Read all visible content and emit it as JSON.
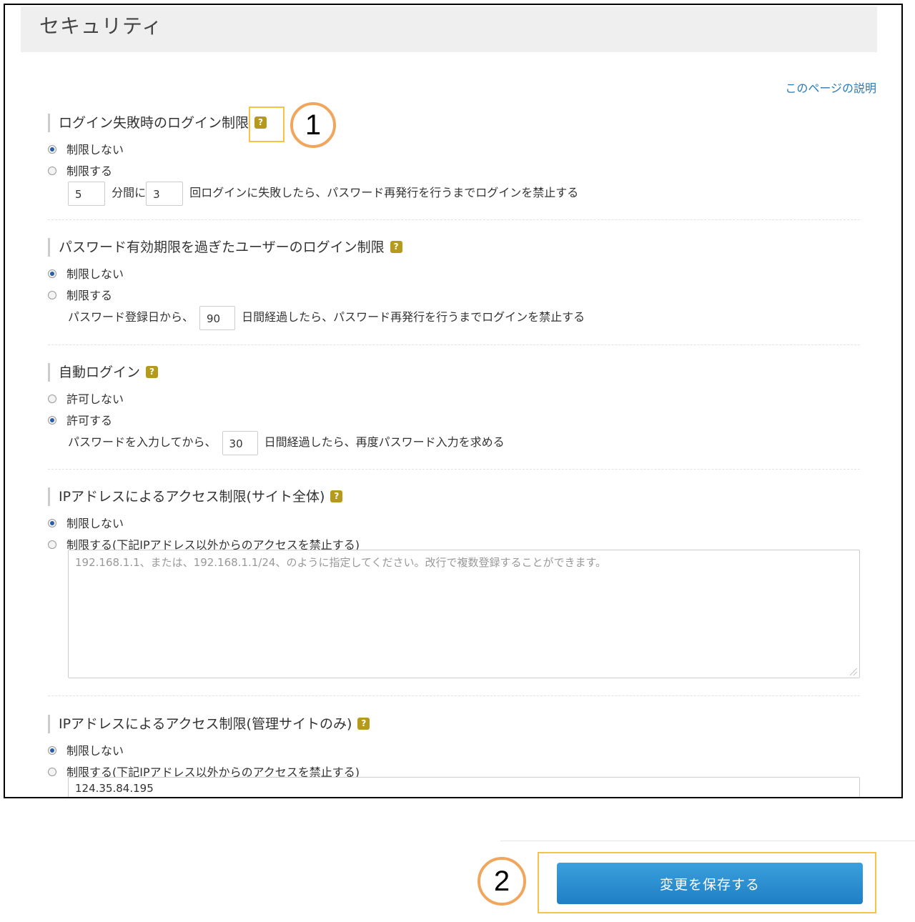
{
  "page": {
    "title": "セキュリティ",
    "help_link": "このページの説明"
  },
  "sections": [
    {
      "title": "ログイン失敗時のログイン制限",
      "options": [
        {
          "label": "制限しない",
          "selected": true
        },
        {
          "label": "制限する",
          "selected": false
        }
      ],
      "detail": {
        "minutes": "5",
        "text_minutes": "分間に",
        "count": "3",
        "text_after": "回ログインに失敗したら、パスワード再発行を行うまでログインを禁止する"
      }
    },
    {
      "title": "パスワード有効期限を過ぎたユーザーのログイン制限",
      "options": [
        {
          "label": "制限しない",
          "selected": true
        },
        {
          "label": "制限する",
          "selected": false
        }
      ],
      "detail": {
        "text_before": "パスワード登録日から、",
        "days": "90",
        "text_after": "日間経過したら、パスワード再発行を行うまでログインを禁止する"
      }
    },
    {
      "title": "自動ログイン",
      "options": [
        {
          "label": "許可しない",
          "selected": false
        },
        {
          "label": "許可する",
          "selected": true
        }
      ],
      "detail": {
        "text_before": "パスワードを入力してから、",
        "days": "30",
        "text_after": "日間経過したら、再度パスワード入力を求める"
      }
    },
    {
      "title": "IPアドレスによるアクセス制限(サイト全体)",
      "options": [
        {
          "label": "制限しない",
          "selected": true
        },
        {
          "label": "制限する(下記IPアドレス以外からのアクセスを禁止する)",
          "selected": false
        }
      ],
      "textarea": {
        "value": "",
        "placeholder": "192.168.1.1、または、192.168.1.1/24、のように指定してください。改行で複数登録することができます。"
      }
    },
    {
      "title": "IPアドレスによるアクセス制限(管理サイトのみ)",
      "options": [
        {
          "label": "制限しない",
          "selected": true
        },
        {
          "label": "制限する(下記IPアドレス以外からのアクセスを禁止する)",
          "selected": false
        }
      ],
      "textarea": {
        "value": "124.35.84.195",
        "placeholder": ""
      }
    }
  ],
  "help_icon_glyph": "?",
  "callouts": {
    "one": "1",
    "two": "2"
  },
  "footer": {
    "save_label": "変更を保存する"
  },
  "colors": {
    "accent": "#2a7ab8",
    "help_icon": "#b59a1c",
    "callout_box": "#f5c345",
    "callout_circle": "#f0a65c",
    "save_button": "#2589cf"
  }
}
